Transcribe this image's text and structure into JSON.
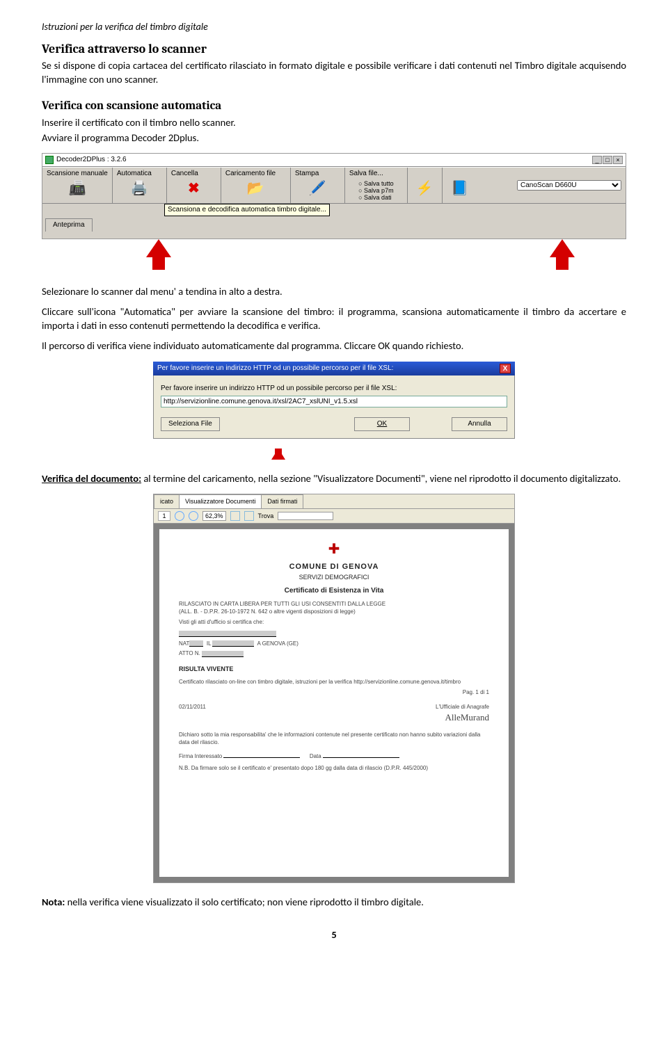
{
  "doc_header": "Istruzioni per la verifica del timbro digitale",
  "h1": "Verifica attraverso lo scanner",
  "p1": "Se si dispone di copia cartacea del certificato rilasciato in formato digitale e possibile verificare i dati contenuti nel Timbro digitale acquisendo l'immagine con uno scanner.",
  "h2": "Verifica con scansione automatica",
  "p2a": "Inserire il certificato con il timbro nello scanner.",
  "p2b": "Avviare il programma Decoder 2Dplus.",
  "shot1": {
    "title": "Decoder2DPlus : 3.2.6",
    "wnd_min": "_",
    "wnd_max": "□",
    "wnd_close": "×",
    "cells": {
      "manuale": "Scansione manuale",
      "automatica": "Automatica",
      "cancella": "Cancella",
      "caricamento": "Caricamento file",
      "stampa": "Stampa",
      "salva": "Salva file...",
      "salva_tutto": "Salva tutto",
      "salva_p7m": "Salva p7m",
      "salva_dati": "Salva dati"
    },
    "scanner": "CanoScan D660U",
    "tooltip": "Scansiona e decodifica automatica timbro digitale...",
    "tab": "Anteprima"
  },
  "p3": "Selezionare lo scanner dal menu' a tendina in alto a destra.",
  "p4": "Cliccare sull'icona \"Automatica\" per avviare la scansione del timbro: il programma, scansiona automaticamente il timbro da accertare e importa i dati in esso contenuti permettendo la decodifica e verifica.",
  "p5": "Il percorso di verifica viene individuato automaticamente dal programma. Cliccare OK quando richiesto.",
  "shot2": {
    "title": "Per favore inserire un indirizzo HTTP od un possibile percorso per il file XSL:",
    "label": "Per favore inserire un indirizzo HTTP od un possibile percorso per il file XSL:",
    "value": "http://servizionline.comune.genova.it/xsl/2AC7_xslUNI_v1.5.xsl",
    "btn_sel": "Seleziona File",
    "btn_ok": "OK",
    "btn_cancel": "Annulla"
  },
  "p6a": "Verifica del documento:",
  "p6b": " al termine del caricamento, nella sezione \"Visualizzatore Documenti\", viene nel riprodotto il documento digitalizzato.",
  "shot3": {
    "tab1": "icato",
    "tab2": "Visualizzatore Documenti",
    "tab3": "Dati firmati",
    "page": "1",
    "zoom": "62,3%",
    "find_lbl": "Trova",
    "doc": {
      "org": "COMUNE DI GENOVA",
      "dept": "SERVIZI DEMOGRAFICI",
      "title": "Certificato di Esistenza in Vita",
      "line1": "RILASCIATO IN CARTA LIBERA PER TUTTI GLI USI CONSENTITI DALLA LEGGE",
      "line2": "(ALL. B. - D.P.R. 26-10-1972 N. 642 o altre vigenti disposizioni di legge)",
      "line3": "Visti gli atti d'ufficio si certifica che:",
      "nat": "NAT",
      "nat_loc": "A GENOVA (GE)",
      "atto": "ATTO N.",
      "risulta": "RISULTA VIVENTE",
      "cert": "Certificato rilasciato on-line con timbro digitale, istruzioni per la verifica http://servizionline.comune.genova.it/timbro",
      "pag": "Pag. 1 di 1",
      "date": "02/11/2011",
      "uff": "L'Ufficiale di Anagrafe",
      "decl": "Dichiaro sotto la mia responsabilita' che le informazioni contenute nel presente certificato non hanno subito variazioni dalla data del rilascio.",
      "firma": "Firma Interessato",
      "data_lbl": "Data",
      "nb": "N.B. Da firmare solo se il certificato e' presentato dopo 180 gg dalla data di rilascio (D.P.R. 445/2000)"
    }
  },
  "p7a": "Nota:",
  "p7b": " nella verifica viene visualizzato il solo certificato; non viene riprodotto il timbro digitale.",
  "page_num": "5"
}
